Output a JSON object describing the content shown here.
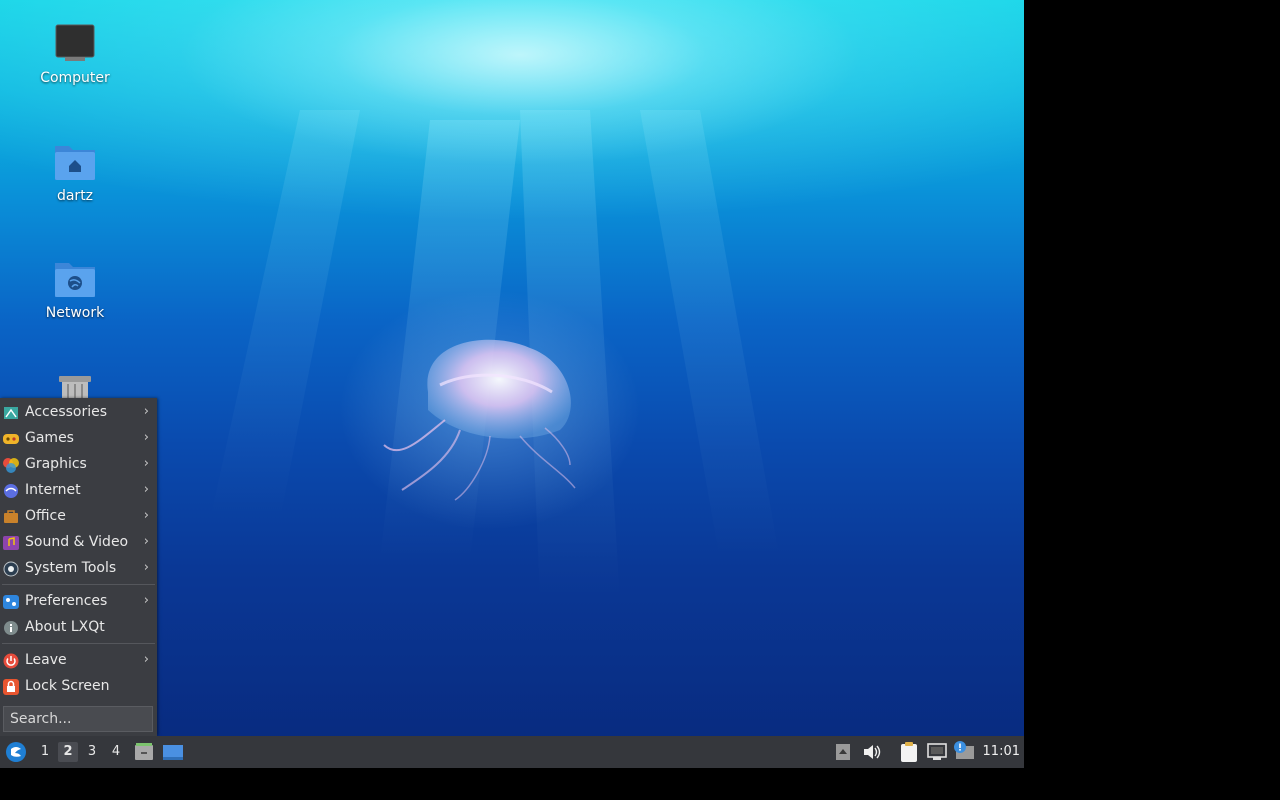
{
  "desktop": {
    "icons": [
      {
        "label": "Computer",
        "icon": "computer-icon"
      },
      {
        "label": "dartz",
        "icon": "home-folder-icon"
      },
      {
        "label": "Network",
        "icon": "network-folder-icon"
      },
      {
        "label": "",
        "icon": "trash-icon"
      }
    ]
  },
  "menu": {
    "items": [
      {
        "label": "Accessories",
        "icon": "accessories-icon",
        "submenu": true
      },
      {
        "label": "Games",
        "icon": "games-icon",
        "submenu": true
      },
      {
        "label": "Graphics",
        "icon": "graphics-icon",
        "submenu": true
      },
      {
        "label": "Internet",
        "icon": "internet-icon",
        "submenu": true
      },
      {
        "label": "Office",
        "icon": "office-icon",
        "submenu": true
      },
      {
        "label": "Sound & Video",
        "icon": "sound-video-icon",
        "submenu": true
      },
      {
        "label": "System Tools",
        "icon": "system-tools-icon",
        "submenu": true
      },
      {
        "label": "Preferences",
        "icon": "preferences-icon",
        "submenu": true
      },
      {
        "label": "About LXQt",
        "icon": "info-icon",
        "submenu": false
      },
      {
        "label": "Leave",
        "icon": "power-icon",
        "submenu": true
      },
      {
        "label": "Lock Screen",
        "icon": "lock-icon",
        "submenu": false
      }
    ],
    "search_placeholder": "Search...",
    "chevron": "›"
  },
  "taskbar": {
    "desktops": [
      "1",
      "2",
      "3",
      "4"
    ],
    "active_desktop": "2",
    "quicklaunch": [
      "file-manager-icon",
      "show-desktop-icon"
    ],
    "tray": [
      "tray-expand-icon",
      "volume-icon",
      "clipboard-icon",
      "network-icon",
      "update-notifier-icon"
    ],
    "clock": "11:01"
  },
  "colors": {
    "panel": "#35373c",
    "menu_bg": "#3b3d42",
    "wallpaper_top": "#12d4e6",
    "wallpaper_bottom": "#08297c"
  }
}
